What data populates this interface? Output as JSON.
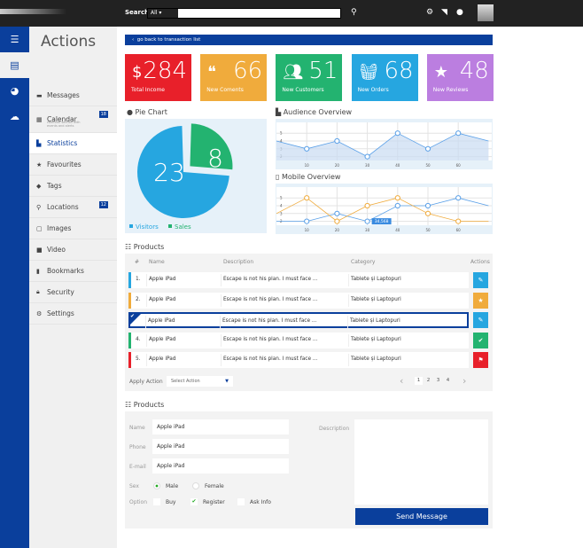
{
  "topbar": {
    "search_label": "Search",
    "search_scope": "All",
    "search_value": "",
    "icons": [
      "search-icon",
      "gear-icon",
      "rss-icon",
      "user-icon"
    ]
  },
  "sidebar": {
    "title": "Actions",
    "rail_icons": [
      "list-icon",
      "inbox-icon",
      "pie-chart-icon",
      "cloud-icon"
    ],
    "items": [
      {
        "label": "Messages",
        "icon": "message-icon"
      },
      {
        "label": "Calendar",
        "sub": "calendar section with events and alerts",
        "badge": "18",
        "icon": "calendar-icon"
      },
      {
        "label": "Statistics",
        "icon": "chart-icon",
        "active": true
      },
      {
        "label": "Favourites",
        "icon": "star-icon"
      },
      {
        "label": "Tags",
        "icon": "tag-icon"
      },
      {
        "label": "Locations",
        "badge": "12",
        "icon": "pin-icon"
      },
      {
        "label": "Images",
        "icon": "image-icon"
      },
      {
        "label": "Video",
        "icon": "video-icon"
      },
      {
        "label": "Bookmarks",
        "icon": "bookmark-icon"
      },
      {
        "label": "Security",
        "icon": "lock-icon"
      },
      {
        "label": "Settings",
        "icon": "gear-icon"
      }
    ]
  },
  "back_link": "go back to transaction list",
  "tiles": [
    {
      "value": "284",
      "label": "Total Income",
      "color": "#e8202a"
    },
    {
      "value": "66",
      "label": "New Coments",
      "color": "#f0ab3c"
    },
    {
      "value": "51",
      "label": "New Customers",
      "color": "#23b370"
    },
    {
      "value": "68",
      "label": "New Orders",
      "color": "#26a6e0"
    },
    {
      "value": "48",
      "label": "New Reviews",
      "color": "#bb7ee0"
    }
  ],
  "pie": {
    "title": "Pie Chart"
  },
  "audience": {
    "title": "Audience Overview"
  },
  "mobile": {
    "title": "Mobile Overview",
    "tooltip": "34,568"
  },
  "chart_data": [
    {
      "type": "pie",
      "title": "Pie Chart",
      "slices": [
        {
          "name": "Visitors",
          "value": 23,
          "color": "#26a6e0"
        },
        {
          "name": "Sales",
          "value": 8,
          "color": "#23b370"
        }
      ]
    },
    {
      "type": "area",
      "title": "Audience Overview",
      "x": [
        0,
        10,
        20,
        30,
        40,
        50,
        60,
        70
      ],
      "xticks": [
        10,
        20,
        30,
        40,
        50,
        60
      ],
      "yticks": [
        2,
        3,
        4,
        5
      ],
      "series": [
        {
          "values": [
            4,
            3,
            4,
            2,
            5,
            3,
            5,
            4
          ],
          "color": "#5aa0e8"
        }
      ],
      "grid": true
    },
    {
      "type": "line",
      "title": "Mobile Overview",
      "x": [
        0,
        10,
        20,
        30,
        40,
        50,
        60,
        70
      ],
      "xticks": [
        10,
        20,
        30,
        40,
        50,
        60
      ],
      "yticks": [
        2,
        3,
        4,
        5
      ],
      "series": [
        {
          "values": [
            2,
            2,
            3,
            2,
            4,
            4,
            5,
            4
          ],
          "color": "#5aa0e8"
        },
        {
          "values": [
            3,
            5,
            2,
            4,
            5,
            3,
            2,
            2
          ],
          "color": "#f0ab3c"
        }
      ],
      "grid": true,
      "tooltip": "34,568"
    }
  ],
  "products": {
    "title": "Products",
    "headers": [
      "#",
      "Name",
      "Description",
      "Category",
      "Actions"
    ],
    "rows": [
      {
        "num": "1.",
        "name": "Apple iPad",
        "desc": "Escape is not his plan. I must face ...",
        "cat": "Tablete și Laptopuri",
        "color": "#26a6e0",
        "action": "edit-icon",
        "action_color": "#26a6e0"
      },
      {
        "num": "2.",
        "name": "Apple iPad",
        "desc": "Escape is not his plan. I must face ...",
        "cat": "Tablete și Laptopuri",
        "color": "#f0ab3c",
        "action": "star-icon",
        "action_color": "#f0ab3c"
      },
      {
        "num": "",
        "name": "Apple iPad",
        "desc": "Escape is not his plan. I must face ...",
        "cat": "Tablete și Laptopuri",
        "color": "#0a3f9c",
        "selected": true,
        "action": "edit-icon",
        "action_color": "#26a6e0"
      },
      {
        "num": "4.",
        "name": "Apple iPad",
        "desc": "Escape is not his plan. I must face ...",
        "cat": "Tablete și Laptopuri",
        "color": "#23b370",
        "action": "check-icon",
        "action_color": "#23b370"
      },
      {
        "num": "5.",
        "name": "Apple iPad",
        "desc": "Escape is not his plan. I must face ...",
        "cat": "Tablete și Laptopuri",
        "color": "#e8202a",
        "action": "flag-icon",
        "action_color": "#e8202a"
      }
    ],
    "apply_label": "Apply Action",
    "select_placeholder": "Select Action",
    "pages": [
      "1",
      "2",
      "3",
      "4"
    ],
    "current_page": "1"
  },
  "form": {
    "title": "Products",
    "name_label": "Name",
    "name_value": "Apple iPad",
    "phone_label": "Phone",
    "phone_value": "Apple iPad",
    "email_label": "E-mail",
    "email_value": "Apple iPad",
    "sex_label": "Sex",
    "male": "Male",
    "female": "Female",
    "sex_selected": "Male",
    "option_label": "Option",
    "opt_buy": "Buy",
    "opt_register": "Register",
    "opt_ask": "Ask Info",
    "checked": [
      "Register"
    ],
    "desc_label": "Description",
    "desc_value": "",
    "send": "Send Message"
  }
}
